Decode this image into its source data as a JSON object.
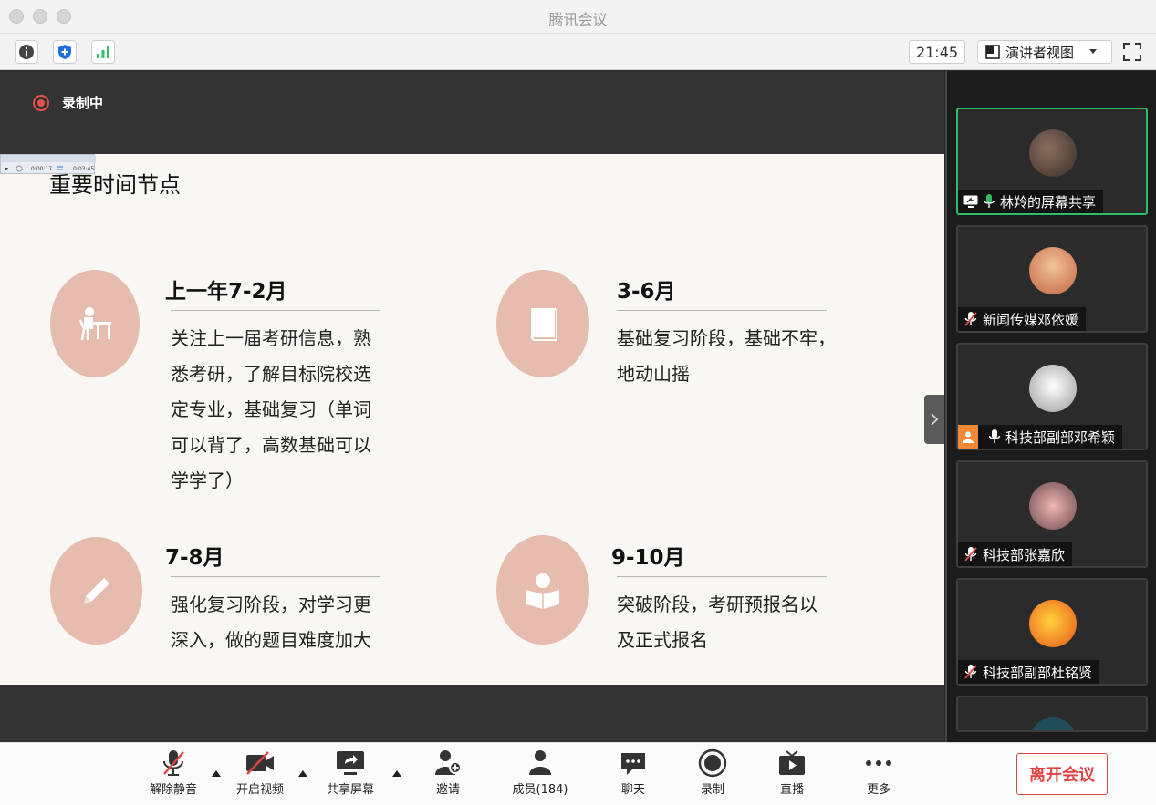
{
  "window": {
    "title": "腾讯会议"
  },
  "toolbar": {
    "clock": "21:45",
    "view_label": "演讲者视图"
  },
  "recording": {
    "label": "录制中"
  },
  "slide": {
    "title": "重要时间节点",
    "blocks": [
      {
        "heading": "上一年7-2月",
        "body": "关注上一届考研信息，熟\n悉考研，了解目标院校选\n定专业，基础复习（单词\n可以背了，高数基础可以\n学学了）"
      },
      {
        "heading": "3-6月",
        "body": "基础复习阶段，基础不牢，\n地动山摇"
      },
      {
        "heading": "7-8月",
        "body": "强化复习阶段，对学习更\n深入，做的题目难度加大"
      },
      {
        "heading": "9-10月",
        "body": "突破阶段，考研预报名以\n及正式报名"
      }
    ],
    "mini_player": {
      "time_current": "0:00:17",
      "time_total": "0:03:45"
    }
  },
  "participants": [
    {
      "name": "林羚的屏幕共享",
      "mic": "on",
      "screen_share": true,
      "active": true
    },
    {
      "name": "新闻传媒邓依媛",
      "mic": "muted"
    },
    {
      "name": "科技部副部邓希颖",
      "mic": "on",
      "host": true
    },
    {
      "name": "科技部张嘉欣",
      "mic": "muted"
    },
    {
      "name": "科技部副部杜铭贤",
      "mic": "muted"
    }
  ],
  "controls": {
    "unmute": "解除静音",
    "video": "开启视频",
    "share": "共享屏幕",
    "invite": "邀请",
    "members": "成员(184)",
    "chat": "聊天",
    "record": "录制",
    "live": "直播",
    "more": "更多",
    "leave": "离开会议"
  },
  "colors": {
    "accent_green": "#2fbf62",
    "slide_circle": "#e5bcae",
    "leave_red": "#e04545",
    "rec_red": "#e35050"
  }
}
